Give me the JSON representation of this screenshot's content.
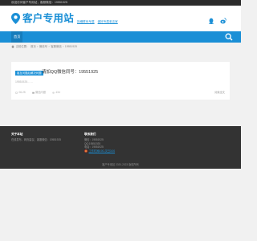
{
  "topbar": {
    "text": "欢迎访问客户专用站，客服微信：19551925"
  },
  "header": {
    "logo_text": "客户专用站",
    "links": [
      "投稿联系专属",
      "做好专属老店家"
    ]
  },
  "nav": {
    "home_label": "首页"
  },
  "breadcrumb": {
    "items": [
      "当前位置：",
      "首页",
      "›",
      "微信号",
      "›",
      "客服微信",
      "›",
      "19551925"
    ]
  },
  "post": {
    "tag": "客互问题后解决问题",
    "title": "请加QQ微信同号：19551925",
    "excerpt": "19551925……",
    "meta": {
      "date": "06-25",
      "category": "微信问题",
      "views": "434"
    },
    "read_more": "阅读全文"
  },
  "footer": {
    "col1_title": "关于本站",
    "col1_text": "在线发布、网页建议、客服微信：19551925",
    "col2_title": "联系我们",
    "col2_lines": [
      "微信：19551925",
      "QQ:19551925",
      "电话：19551925"
    ],
    "col2_link": "工作时间8:00-次日3:00",
    "copyright": "客户专用站 2020-2023 版权所有"
  },
  "colors": {
    "accent": "#1a8fd6",
    "topbar": "#2b2b2b",
    "footer": "#333333",
    "background": "#f1f1f1"
  },
  "icons": [
    "map-pin-logo-icon",
    "qq-icon",
    "weibo-icon",
    "search-icon",
    "home-icon",
    "clock-icon",
    "folder-icon",
    "eye-icon",
    "badge-icon"
  ]
}
